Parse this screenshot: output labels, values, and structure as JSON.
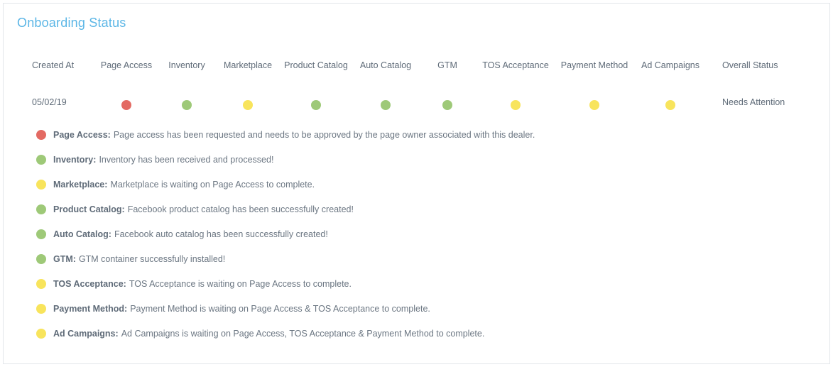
{
  "panel": {
    "title": "Onboarding Status"
  },
  "colors": {
    "red": "#e36a63",
    "green": "#9ec978",
    "yellow": "#f8e45c",
    "title": "#5bb6e6"
  },
  "table": {
    "headers": {
      "created_at": "Created At",
      "page_access": "Page Access",
      "inventory": "Inventory",
      "marketplace": "Marketplace",
      "product_catalog": "Product Catalog",
      "auto_catalog": "Auto Catalog",
      "gtm": "GTM",
      "tos_acceptance": "TOS Acceptance",
      "payment_method": "Payment Method",
      "ad_campaigns": "Ad Campaigns",
      "overall_status": "Overall Status"
    },
    "row": {
      "created_at": "05/02/19",
      "page_access": "red",
      "inventory": "green",
      "marketplace": "yellow",
      "product_catalog": "green",
      "auto_catalog": "green",
      "gtm": "green",
      "tos_acceptance": "yellow",
      "payment_method": "yellow",
      "ad_campaigns": "yellow",
      "overall_status": "Needs Attention"
    }
  },
  "legend": [
    {
      "status": "red",
      "name": "Page Access:",
      "text": "Page access has been requested and needs to be approved by the page owner associated with this dealer."
    },
    {
      "status": "green",
      "name": "Inventory:",
      "text": "Inventory has been received and processed!"
    },
    {
      "status": "yellow",
      "name": "Marketplace:",
      "text": "Marketplace is waiting on Page Access to complete."
    },
    {
      "status": "green",
      "name": "Product Catalog:",
      "text": "Facebook product catalog has been successfully created!"
    },
    {
      "status": "green",
      "name": "Auto Catalog:",
      "text": "Facebook auto catalog has been successfully created!"
    },
    {
      "status": "green",
      "name": "GTM:",
      "text": "GTM container successfully installed!"
    },
    {
      "status": "yellow",
      "name": "TOS Acceptance:",
      "text": "TOS Acceptance is waiting on Page Access to complete."
    },
    {
      "status": "yellow",
      "name": "Payment Method:",
      "text": "Payment Method is waiting on Page Access & TOS Acceptance to complete."
    },
    {
      "status": "yellow",
      "name": "Ad Campaigns:",
      "text": "Ad Campaigns is waiting on Page Access, TOS Acceptance & Payment Method to complete."
    }
  ]
}
